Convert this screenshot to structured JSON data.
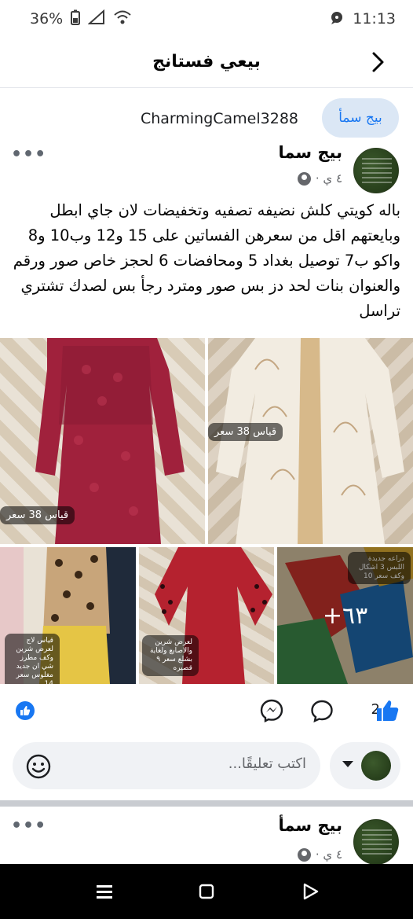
{
  "status_bar": {
    "battery_percent": "36%",
    "time": "11:13",
    "icons": [
      "battery-icon",
      "signal-icon",
      "wifi-icon",
      "messenger-bubble-icon"
    ]
  },
  "header": {
    "title": "بيعي فستانج",
    "back_icon": "chevron-right-icon"
  },
  "seller": {
    "pill_label": "بيج سمأ",
    "username": "CharmingCamel3288"
  },
  "post": {
    "author": "بيج سما",
    "time": "٤ ي ·",
    "privacy_icon": "public-globe-icon",
    "text": "باله كويتي كلش نضيفه تصفيه وتخفيضات لان جاي ابطل وبايعتهم اقل من سعرهن الفساتين على 15 و12 وب10 و8 واكو ب7 توصيل بغداد 5 ومحافضات 6 لحجز خاص صور ورقم والعنوان بنات لحد دز بس صور ومترد رجأ بس لصدك تشتري تراسل",
    "photos": {
      "photo1_tag": "قياس 38 سعر",
      "photo2_tag": "قياس 38 سعر",
      "photo3_tag": "قياس لاج لعرض شرين وكف مطرز شي ان جديد مغلوس سعر 14",
      "photo4_tag": "لعرض شرين والاصابع ولغاية بشلع سعر ٩ قصيره",
      "photo5_tag": "دراعه جديدة اللبس 3 اشكال وكف سعر 10",
      "more_count": "٦٣+"
    },
    "reactions": {
      "like_count": "2"
    },
    "comment_placeholder": "اكتب تعليقًا..."
  },
  "post2": {
    "author": "بيج سمأ",
    "time": "٤ ي ·"
  },
  "nav_bar": {
    "buttons": [
      "recent-apps-icon",
      "home-icon",
      "back-icon"
    ]
  },
  "colors": {
    "brand_blue": "#1877f2",
    "pill_bg": "#dbe7f5",
    "input_bg": "#f0f2f5"
  }
}
